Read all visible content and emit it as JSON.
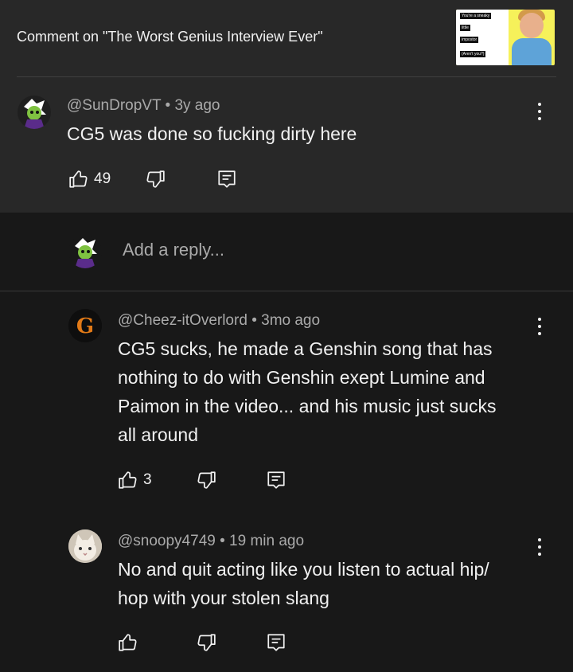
{
  "header": {
    "title": "Comment on \"The Worst Genius Interview Ever\"",
    "thumbnail": {
      "lines": [
        "You're a sneaky",
        "little",
        "impostor",
        "(Aren't you?)"
      ]
    }
  },
  "main_comment": {
    "author": "@SunDropVT",
    "time": "3y ago",
    "text": "CG5 was done so fucking dirty here",
    "likes": "49"
  },
  "reply_box": {
    "placeholder": "Add a reply..."
  },
  "replies": [
    {
      "author": "@Cheez-itOverlord",
      "time": "3mo ago",
      "lines": [
        "CG5 sucks, he made a Genshin song that has",
        "nothing to do with Genshin exept Lumine and",
        "Paimon in the video... and his music just sucks",
        "all around"
      ],
      "likes": "3",
      "avatar_letter": "G"
    },
    {
      "author": "@snoopy4749",
      "time": "19 min ago",
      "lines": [
        "No and quit acting like you listen to actual hip/",
        "hop with your stolen slang"
      ],
      "likes": ""
    }
  ],
  "separator": "•",
  "colors": {
    "panel": "#282828",
    "background": "#181818",
    "text": "#f1f1f1",
    "muted": "#aaaaaa"
  }
}
